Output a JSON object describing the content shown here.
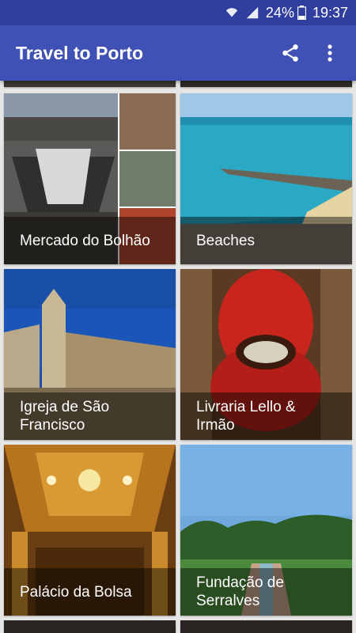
{
  "status": {
    "battery": "24%",
    "time": "19:37"
  },
  "appbar": {
    "title": "Travel to Porto",
    "share_icon": "share-icon",
    "menu_icon": "more-vert-icon"
  },
  "colors": {
    "status_bar": "#303f9f",
    "app_bar": "#3f51b5",
    "caption_overlay": "rgba(0,0,0,0.45)"
  },
  "tiles": [
    {
      "label": "Mercado do Bolhão"
    },
    {
      "label": "Beaches"
    },
    {
      "label": "Igreja de São Francisco"
    },
    {
      "label": "Livraria Lello & Irmão"
    },
    {
      "label": "Palácio da Bolsa"
    },
    {
      "label": "Fundação de Serralves"
    }
  ]
}
